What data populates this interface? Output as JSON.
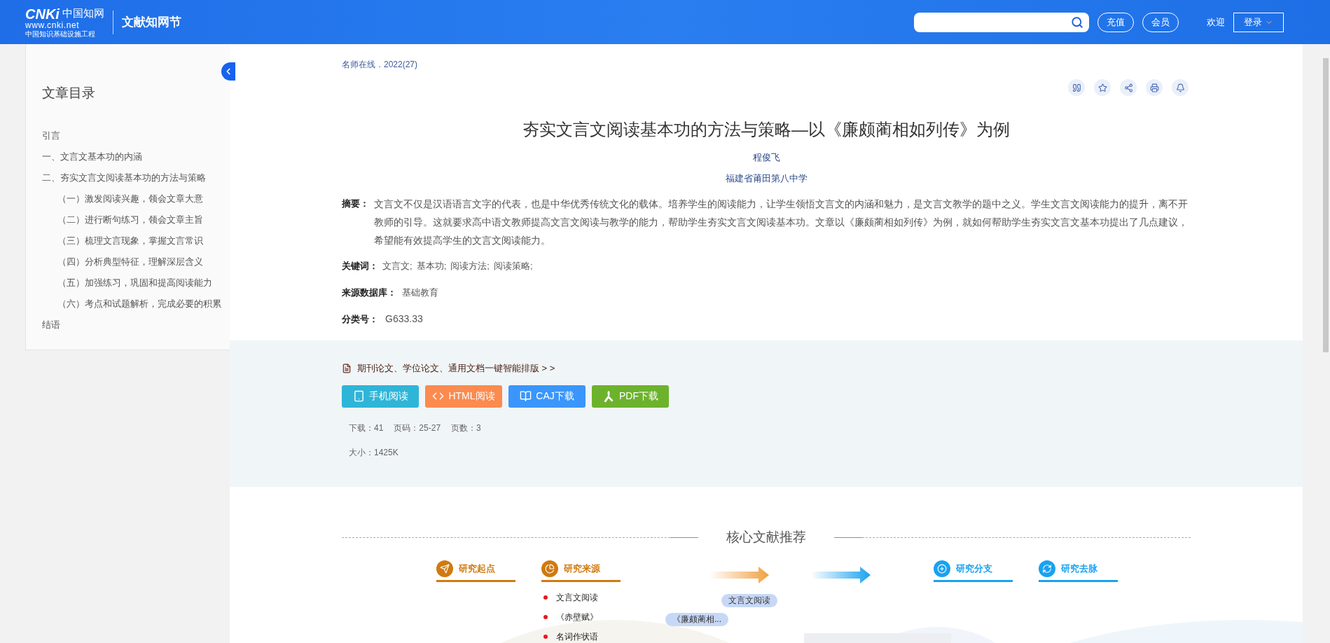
{
  "header": {
    "logo_mark": "CNKi",
    "logo_text": "www.cnki.net",
    "logo_subtitle": "中国知识基础设施工程",
    "logo_cn": "中国知网",
    "site_name": "文献知网节",
    "buttons": [
      "充值",
      "会员"
    ],
    "welcome": "欢迎",
    "login": "登录"
  },
  "toc": {
    "title": "文章目录",
    "items": [
      {
        "label": "引言"
      },
      {
        "label": "一、文言文基本功的内涵"
      },
      {
        "label": "二、夯实文言文阅读基本功的方法与策略",
        "children": [
          {
            "label": "（一）激发阅读兴趣，领会文章大意"
          },
          {
            "label": "（二）进行断句练习，领会文章主旨"
          },
          {
            "label": "（三）梳理文言现象，掌握文言常识"
          },
          {
            "label": "（四）分析典型特征，理解深层含义"
          },
          {
            "label": "（五）加强练习，巩固和提高阅读能力"
          },
          {
            "label": "（六）考点和试题解析，完成必要的积累"
          }
        ]
      },
      {
        "label": "结语"
      }
    ]
  },
  "article": {
    "source": "名师在线．2022(27)",
    "title": "夯实文言文阅读基本功的方法与策略—以《廉颇蔺相如列传》为例",
    "author": "程俊飞",
    "organization": "福建省莆田第八中学",
    "abstract_label": "摘要：",
    "abstract": "文言文不仅是汉语语言文字的代表，也是中华优秀传统文化的载体。培养学生的阅读能力，让学生领悟文言文的内涵和魅力，是文言文教学的题中之义。学生文言文阅读能力的提升，离不开教师的引导。这就要求高中语文教师提高文言文阅读与教学的能力，帮助学生夯实文言文阅读基本功。文章以《廉颇蔺相如列传》为例，就如何帮助学生夯实文言文基本功提出了几点建议，希望能有效提高学生的文言文阅读能力。",
    "keywords_label": "关键词：",
    "keywords": [
      "文言文;",
      "基本功;",
      "阅读方法;",
      "阅读策略;"
    ],
    "database_label": "来源数据库：",
    "database": "基础教育",
    "class_label": "分类号：",
    "class_number": "G633.33"
  },
  "download": {
    "format_link": "期刊论文、学位论文、通用文档一键智能排版 > >",
    "buttons": [
      {
        "kind": "mobile",
        "label": "手机阅读"
      },
      {
        "kind": "html",
        "label": "HTML阅读"
      },
      {
        "kind": "caj",
        "label": "CAJ下载"
      },
      {
        "kind": "pdf",
        "label": "PDF下载"
      }
    ],
    "stats": [
      "下载：41",
      "页码：25-27",
      "页数：3"
    ],
    "size": "大小：1425K"
  },
  "recommend": {
    "title": "核心文献推荐",
    "tabs": [
      {
        "kind": "start",
        "label": "研究起点",
        "color": "#d07a10"
      },
      {
        "kind": "source",
        "label": "研究来源",
        "color": "#d07a10"
      },
      {
        "kind": "branch",
        "label": "研究分支",
        "color": "#19a2f0"
      },
      {
        "kind": "trend",
        "label": "研究去脉",
        "color": "#19a2f0"
      }
    ],
    "sources": [
      "文言文阅读",
      "《赤壁赋》",
      "名词作状语"
    ],
    "bubbles": [
      "文言文阅读",
      "《廉颇蔺相..."
    ]
  }
}
